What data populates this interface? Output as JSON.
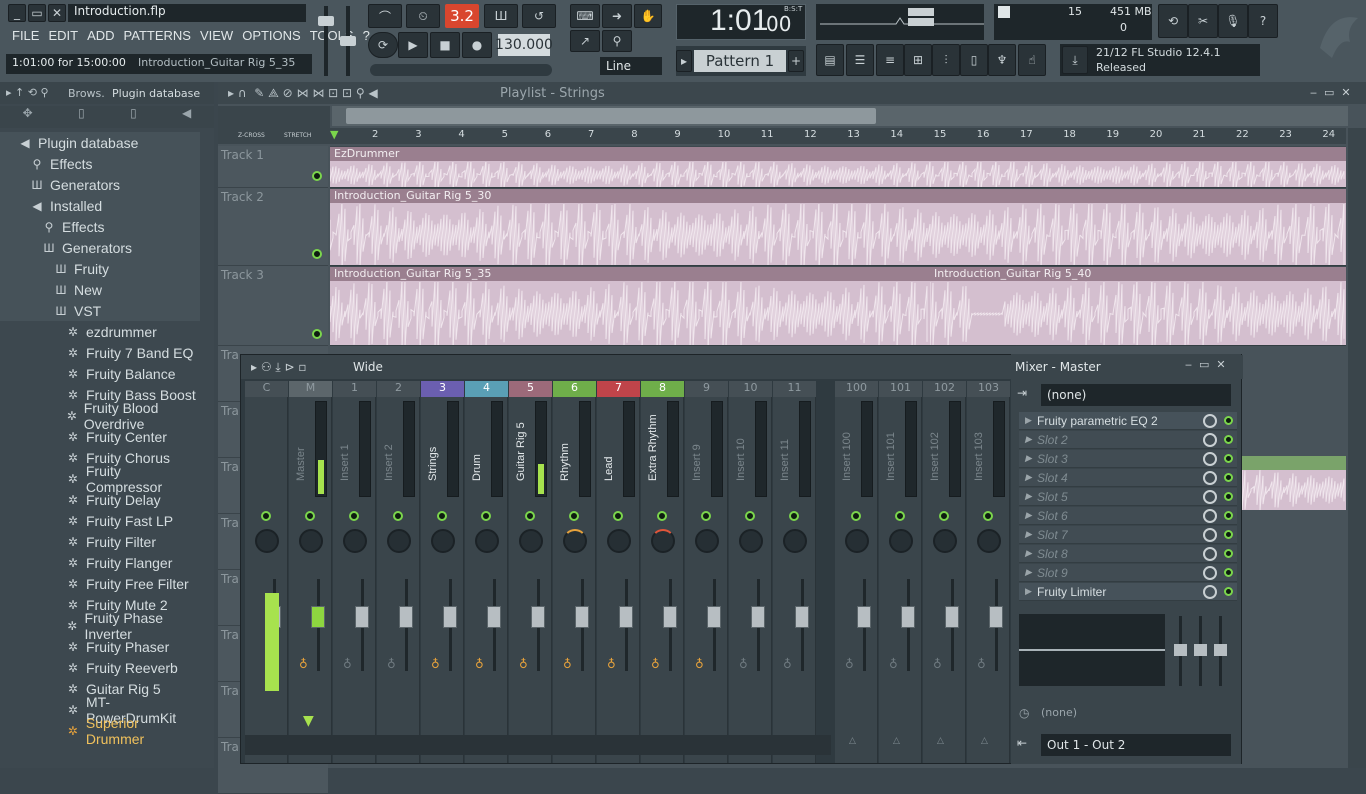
{
  "title_file": "Introduction.flp",
  "menu": [
    "FILE",
    "EDIT",
    "ADD",
    "PATTERNS",
    "VIEW",
    "OPTIONS",
    "TOOLS",
    "?"
  ],
  "status": {
    "time_info": "1:01:00 for 15:00:00",
    "hint": "Introduction_Guitar Rig 5_35"
  },
  "transport": {
    "tempo_text": "3.2",
    "bpm": "130.000",
    "snap": "Line",
    "time_main": "1:01",
    "time_sub": "00",
    "time_label": "B:S:T"
  },
  "pattern": {
    "label": "Pattern 1"
  },
  "cpu": {
    "value": "15",
    "memory": "451 MB",
    "poly": "0"
  },
  "news": {
    "text": "21/12  FL Studio 12.4.1",
    "status": "Released"
  },
  "browser": {
    "crumb1": "Brows.",
    "crumb2": "Plugin database",
    "items": [
      {
        "label": "Plugin database",
        "indent": 0,
        "icon": "speaker-icon"
      },
      {
        "label": "Effects",
        "indent": 1,
        "icon": "plug-icon"
      },
      {
        "label": "Generators",
        "indent": 1,
        "icon": "generator-icon"
      },
      {
        "label": "Installed",
        "indent": 1,
        "icon": "speaker-icon"
      },
      {
        "label": "Effects",
        "indent": 2,
        "icon": "plug-icon"
      },
      {
        "label": "Generators",
        "indent": 2,
        "icon": "generator-icon"
      },
      {
        "label": "Fruity",
        "indent": 3,
        "icon": "generator-icon"
      },
      {
        "label": "New",
        "indent": 3,
        "icon": "generator-icon"
      },
      {
        "label": "VST",
        "indent": 3,
        "icon": "generator-icon"
      },
      {
        "label": "ezdrummer",
        "indent": 4,
        "icon": "gear-icon"
      },
      {
        "label": "Fruity 7 Band EQ",
        "indent": 4,
        "icon": "gear-icon"
      },
      {
        "label": "Fruity Balance",
        "indent": 4,
        "icon": "gear-icon"
      },
      {
        "label": "Fruity Bass Boost",
        "indent": 4,
        "icon": "gear-icon"
      },
      {
        "label": "Fruity Blood Overdrive",
        "indent": 4,
        "icon": "gear-icon"
      },
      {
        "label": "Fruity Center",
        "indent": 4,
        "icon": "gear-icon"
      },
      {
        "label": "Fruity Chorus",
        "indent": 4,
        "icon": "gear-icon"
      },
      {
        "label": "Fruity Compressor",
        "indent": 4,
        "icon": "gear-icon"
      },
      {
        "label": "Fruity Delay",
        "indent": 4,
        "icon": "gear-icon"
      },
      {
        "label": "Fruity Fast LP",
        "indent": 4,
        "icon": "gear-icon"
      },
      {
        "label": "Fruity Filter",
        "indent": 4,
        "icon": "gear-icon"
      },
      {
        "label": "Fruity Flanger",
        "indent": 4,
        "icon": "gear-icon"
      },
      {
        "label": "Fruity Free Filter",
        "indent": 4,
        "icon": "gear-icon"
      },
      {
        "label": "Fruity Mute 2",
        "indent": 4,
        "icon": "gear-icon"
      },
      {
        "label": "Fruity Phase Inverter",
        "indent": 4,
        "icon": "gear-icon"
      },
      {
        "label": "Fruity Phaser",
        "indent": 4,
        "icon": "gear-icon"
      },
      {
        "label": "Fruity Reeverb",
        "indent": 4,
        "icon": "gear-icon"
      },
      {
        "label": "Guitar Rig 5",
        "indent": 4,
        "icon": "gear-icon"
      },
      {
        "label": "MT-PowerDrumKit",
        "indent": 4,
        "icon": "gear-icon"
      },
      {
        "label": "Superior Drummer",
        "indent": 4,
        "icon": "gear-icon"
      }
    ]
  },
  "playlist": {
    "title": "Playlist - Strings",
    "zcross": "Z-CROSS",
    "stretch": "STRETCH",
    "bars": [
      "2",
      "3",
      "4",
      "5",
      "6",
      "7",
      "8",
      "9",
      "10",
      "11",
      "12",
      "13",
      "14",
      "15",
      "16",
      "17",
      "18",
      "19",
      "20",
      "21",
      "22",
      "23",
      "24"
    ],
    "tracks": [
      {
        "label": "Track 1",
        "clips": [
          {
            "name": "EzDrummer"
          }
        ]
      },
      {
        "label": "Track 2",
        "clips": [
          {
            "name": "Introduction_Guitar Rig 5_30"
          }
        ]
      },
      {
        "label": "Track 3",
        "clips": [
          {
            "name": "Introduction_Guitar Rig 5_35"
          },
          {
            "name": "Introduction_Guitar Rig 5_40"
          }
        ]
      }
    ],
    "hidden_tracks_label": "Tra"
  },
  "mixer": {
    "preset": "Wide",
    "title": "Mixer - Master",
    "strips": [
      {
        "num": "C",
        "name": "",
        "color": "#454f55",
        "active": false
      },
      {
        "num": "M",
        "name": "Master",
        "color": "#5c666b",
        "active": false
      },
      {
        "num": "1",
        "name": "Insert 1",
        "color": "#454f55",
        "active": false
      },
      {
        "num": "2",
        "name": "Insert 2",
        "color": "#454f55",
        "active": false
      },
      {
        "num": "3",
        "name": "Strings",
        "color": "#6b5fb0",
        "active": true
      },
      {
        "num": "4",
        "name": "Drum",
        "color": "#5a9fb5",
        "active": true
      },
      {
        "num": "5",
        "name": "Guitar Rig 5",
        "color": "#9c6a7a",
        "active": true
      },
      {
        "num": "6",
        "name": "Rhythm",
        "color": "#6fae4a",
        "active": true
      },
      {
        "num": "7",
        "name": "Lead",
        "color": "#c0444a",
        "active": true
      },
      {
        "num": "8",
        "name": "Extra Rhythm",
        "color": "#6fae4a",
        "active": true
      },
      {
        "num": "9",
        "name": "Insert 9",
        "color": "#454f55",
        "active": false
      },
      {
        "num": "10",
        "name": "Insert 10",
        "color": "#454f55",
        "active": false
      },
      {
        "num": "11",
        "name": "Insert 11",
        "color": "#454f55",
        "active": false
      },
      {
        "num": "100",
        "name": "Insert 100",
        "color": "#454f55",
        "active": false
      },
      {
        "num": "101",
        "name": "Insert 101",
        "color": "#454f55",
        "active": false
      },
      {
        "num": "102",
        "name": "Insert 102",
        "color": "#454f55",
        "active": false
      },
      {
        "num": "103",
        "name": "Insert 103",
        "color": "#454f55",
        "active": false
      }
    ],
    "input": "(none)",
    "slots": [
      {
        "label": "Fruity parametric EQ 2",
        "empty": false
      },
      {
        "label": "Slot 2",
        "empty": true
      },
      {
        "label": "Slot 3",
        "empty": true
      },
      {
        "label": "Slot 4",
        "empty": true
      },
      {
        "label": "Slot 5",
        "empty": true
      },
      {
        "label": "Slot 6",
        "empty": true
      },
      {
        "label": "Slot 7",
        "empty": true
      },
      {
        "label": "Slot 8",
        "empty": true
      },
      {
        "label": "Slot 9",
        "empty": true
      },
      {
        "label": "Fruity Limiter",
        "empty": false
      }
    ],
    "send": "(none)",
    "output": "Out 1 - Out 2"
  },
  "colors": {
    "accent": "#7bd64c",
    "clip": "#d4bfcf",
    "clip_title": "#9a7f8f"
  }
}
